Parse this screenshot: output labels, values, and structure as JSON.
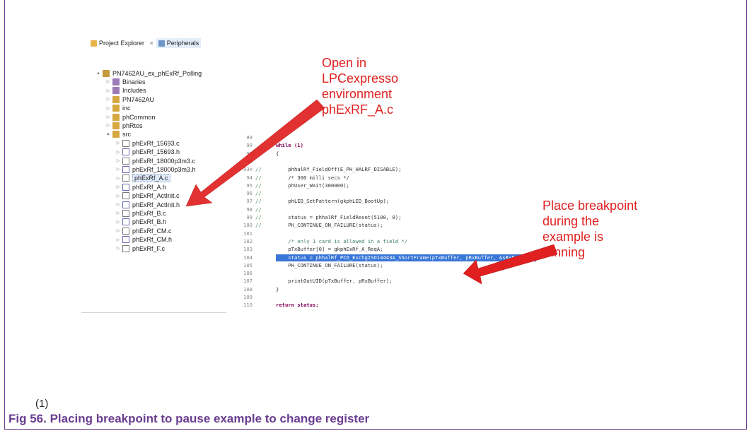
{
  "tabs": {
    "project_explorer": "Project Explorer",
    "peripherals": "Peripherals"
  },
  "tree": [
    {
      "name": "PN7462AU_ex_phExRf_Polling",
      "kind": "proj",
      "indent": 0,
      "twisty": "▲"
    },
    {
      "name": "Binaries",
      "kind": "lib",
      "indent": 1,
      "twisty": "▷"
    },
    {
      "name": "Includes",
      "kind": "lib",
      "indent": 1,
      "twisty": "▷"
    },
    {
      "name": "PN7462AU",
      "kind": "folder",
      "indent": 1,
      "twisty": "▷"
    },
    {
      "name": "inc",
      "kind": "folder",
      "indent": 1,
      "twisty": "▷"
    },
    {
      "name": "phCommon",
      "kind": "folder",
      "indent": 1,
      "twisty": "▷"
    },
    {
      "name": "phRtos",
      "kind": "folder",
      "indent": 1,
      "twisty": "▷"
    },
    {
      "name": "src",
      "kind": "folder",
      "indent": 1,
      "twisty": "▲"
    },
    {
      "name": "phExRf_15693.c",
      "kind": "c",
      "indent": 2,
      "twisty": "▷"
    },
    {
      "name": "phExRf_15693.h",
      "kind": "h",
      "indent": 2,
      "twisty": "▷"
    },
    {
      "name": "phExRf_18000p3m3.c",
      "kind": "c",
      "indent": 2,
      "twisty": "▷"
    },
    {
      "name": "phExRf_18000p3m3.h",
      "kind": "h",
      "indent": 2,
      "twisty": "▷"
    },
    {
      "name": "phExRf_A.c",
      "kind": "c",
      "indent": 2,
      "twisty": "▷",
      "selected": true
    },
    {
      "name": "phExRf_A.h",
      "kind": "h",
      "indent": 2,
      "twisty": "▷"
    },
    {
      "name": "phExRf_ActInit.c",
      "kind": "c",
      "indent": 2,
      "twisty": "▷"
    },
    {
      "name": "phExRf_ActInit.h",
      "kind": "h",
      "indent": 2,
      "twisty": "▷"
    },
    {
      "name": "phExRf_B.c",
      "kind": "c",
      "indent": 2,
      "twisty": "▷"
    },
    {
      "name": "phExRf_B.h",
      "kind": "h",
      "indent": 2,
      "twisty": "▷"
    },
    {
      "name": "phExRf_CM.c",
      "kind": "c",
      "indent": 2,
      "twisty": "▷"
    },
    {
      "name": "phExRf_CM.h",
      "kind": "h",
      "indent": 2,
      "twisty": "▷"
    },
    {
      "name": "phExRf_F.c",
      "kind": "c",
      "indent": 2,
      "twisty": "▷"
    }
  ],
  "code": [
    {
      "n": "89",
      "c": "",
      "t": ""
    },
    {
      "n": "90",
      "c": "",
      "t": "while (1)",
      "kw": true
    },
    {
      "n": "91",
      "c": "",
      "t": "{"
    },
    {
      "n": "92",
      "c": "",
      "t": ""
    },
    {
      "n": "93⊖",
      "c": "//",
      "t": "    phhalRf_FieldOff(E_PH_HALRF_DISABLE);"
    },
    {
      "n": "94",
      "c": "//",
      "t": "    /* 300 milli secs */"
    },
    {
      "n": "95",
      "c": "//",
      "t": "    phUser_Wait(300000);"
    },
    {
      "n": "96",
      "c": "//",
      "t": ""
    },
    {
      "n": "97",
      "c": "//",
      "t": "    phLED_SetPattern(gkphLED_BootUp);"
    },
    {
      "n": "98",
      "c": "//",
      "t": ""
    },
    {
      "n": "99",
      "c": "//",
      "t": "    status = phhalRf_FieldReset(5100, 0);"
    },
    {
      "n": "100",
      "c": "//",
      "t": "    PH_CONTINUE_ON_FAILURE(status);"
    },
    {
      "n": "101",
      "c": "",
      "t": ""
    },
    {
      "n": "102",
      "c": "",
      "t": "    /* only 1 card is allowed in a field */",
      "green": true
    },
    {
      "n": "103",
      "c": "",
      "t": "    pTxBuffer[0] = gkphExRf_A_ReqA;"
    },
    {
      "n": "104",
      "c": "",
      "t": "    status = phhalRf_PCD_ExchgISO14443A_ShortFrame(pTxBuffer, pRxBuffer, &sRxParams);",
      "hl": true
    },
    {
      "n": "105",
      "c": "",
      "t": "    PH_CONTINUE_ON_FAILURE(status);"
    },
    {
      "n": "106",
      "c": "",
      "t": ""
    },
    {
      "n": "107",
      "c": "",
      "t": "    printOutUID(pTxBuffer, pRxBuffer);"
    },
    {
      "n": "108",
      "c": "",
      "t": "}"
    },
    {
      "n": "109",
      "c": "",
      "t": ""
    },
    {
      "n": "110",
      "c": "",
      "t": "return status;",
      "kw": true
    }
  ],
  "annotations": {
    "open": [
      "Open in",
      "LPCexpresso",
      "environment",
      "phExRF_A.c"
    ],
    "breakpoint": [
      "Place breakpoint",
      "during the",
      "example is",
      "running"
    ]
  },
  "footnote": "(1)",
  "caption": "Fig 56.   Placing breakpoint to pause example to change register",
  "colors": {
    "annotation": "#e02020",
    "caption": "#6a3d8f",
    "highlight": "#3875d7"
  }
}
